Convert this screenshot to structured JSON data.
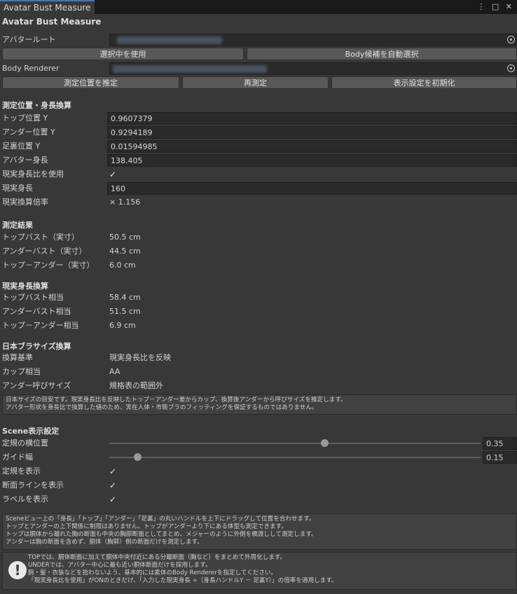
{
  "window": {
    "tab_title": "Avatar Bust Measure"
  },
  "title": "Avatar Bust Measure",
  "avatar_root": {
    "label": "アバタールート"
  },
  "buttons": {
    "use_selection": "選択中を使用",
    "auto_select_body": "Body候補を自動選択",
    "estimate_position": "測定位置を推定",
    "remeasure": "再測定",
    "reset_display": "表示設定を初期化"
  },
  "body_renderer": {
    "label": "Body Renderer"
  },
  "measure_section": {
    "title": "測定位置・身長換算",
    "top_y": {
      "label": "トップ位置 Y",
      "value": "0.9607379"
    },
    "under_y": {
      "label": "アンダー位置 Y",
      "value": "0.9294189"
    },
    "sole_y": {
      "label": "足裏位置 Y",
      "value": "0.01594985"
    },
    "avatar_height": {
      "label": "アバター身長",
      "value": "138.405"
    },
    "use_real_ratio": {
      "label": "現実身長比を使用",
      "checked": true
    },
    "real_height": {
      "label": "現実身長",
      "value": "160"
    },
    "scale": {
      "label": "現実換算倍率",
      "value": "× 1.156"
    }
  },
  "results": {
    "title": "測定結果",
    "rows": [
      {
        "label": "トップバスト（実寸）",
        "value": "50.5 cm"
      },
      {
        "label": "アンダーバスト（実寸）",
        "value": "44.5 cm"
      },
      {
        "label": "トップ－アンダー（実寸）",
        "value": "6.0 cm"
      }
    ]
  },
  "real": {
    "title": "現実身長換算",
    "rows": [
      {
        "label": "トップバスト相当",
        "value": "58.4 cm"
      },
      {
        "label": "アンダーバスト相当",
        "value": "51.5 cm"
      },
      {
        "label": "トップ－アンダー相当",
        "value": "6.9 cm"
      }
    ]
  },
  "jp_size": {
    "title": "日本ブラサイズ換算",
    "rows": [
      {
        "label": "換算基準",
        "value": "現実身長比を反映"
      },
      {
        "label": "カップ相当",
        "value": "AA"
      },
      {
        "label": "アンダー呼びサイズ",
        "value": "規格表の範囲外"
      }
    ],
    "note": [
      "日本サイズの目安です。現実身長比を反映したトップ－アンダー差からカップ、換算後アンダーから呼びサイズを推定します。",
      "アバター形状を身長比で換算した値のため、実在人体・市販ブラのフィッティングを保証するものではありません。"
    ]
  },
  "scene": {
    "title": "Scene表示設定",
    "ruler_pos": {
      "label": "定規の横位置",
      "value": "0.35",
      "fraction": 0.58
    },
    "guide_width": {
      "label": "ガイド幅",
      "value": "0.15",
      "fraction": 0.075
    },
    "show_ruler": {
      "label": "定規を表示",
      "checked": true
    },
    "show_section": {
      "label": "断面ラインを表示",
      "checked": true
    },
    "show_labels": {
      "label": "ラベルを表示",
      "checked": true
    },
    "help": [
      "Sceneビュー上の「身長」「トップ」「アンダー」「足裏」の丸いハンドルを上下にドラッグして位置を合わせます。",
      "トップとアンダーの上下関係に制限はありません。トップがアンダーより下にある体型も測定できます。",
      "トップは胴体から離れた胸の断面も中央の胸部断面としてまとめ、メジャーのように外側を橋渡しして測定します。",
      "アンダーは胸の断面を含めず、胴体（胸郭）側の断面だけを測定します。"
    ]
  },
  "warning": {
    "icon": "exclamation-icon",
    "lines": [
      "TOPでは、胴体断面に加えて胴体中央付近にある分離断面（胸など）をまとめて外周化します。",
      "UNDERでは、アバター中心に最も近い胴体断面だけを採用します。",
      "腕・髪・衣装などを拾わないよう、基本的には素体のBody Rendererを指定してください。",
      "「現実身長比を使用」がONのときだけ、「入力した現実身長 ÷（身長ハンドルY － 足裏Y）」の倍率を適用します。"
    ]
  },
  "colors": {
    "background": "#383838",
    "field": "#2a2a2a",
    "button": "#585858",
    "accent_tab": "#3a79bb"
  }
}
